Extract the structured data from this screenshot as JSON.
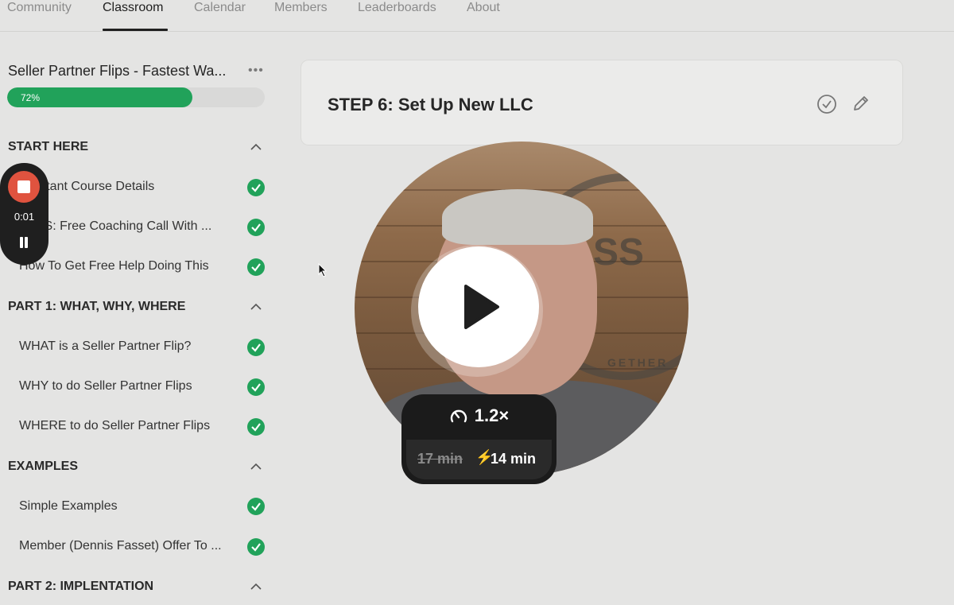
{
  "nav": {
    "tabs": [
      {
        "label": "Community"
      },
      {
        "label": "Classroom"
      },
      {
        "label": "Calendar"
      },
      {
        "label": "Members"
      },
      {
        "label": "Leaderboards"
      },
      {
        "label": "About"
      }
    ],
    "active_tab": "Classroom"
  },
  "course": {
    "title": "Seller Partner Flips - Fastest Wa...",
    "progress_percent": 72,
    "progress_label": "72%",
    "accent_color": "#21a25a"
  },
  "sections": [
    {
      "title": "START HERE",
      "lessons": [
        {
          "label": "Important Course Details",
          "visible_label": "ortant Course Details",
          "completed": true
        },
        {
          "label": "BONUS: Free Coaching Call With ...",
          "visible_label": "US: Free Coaching Call With ...",
          "completed": true
        },
        {
          "label": "How To Get Free Help Doing This",
          "completed": true
        }
      ]
    },
    {
      "title": "PART 1: WHAT, WHY, WHERE",
      "lessons": [
        {
          "label": "WHAT is a Seller Partner Flip?",
          "completed": true
        },
        {
          "label": "WHY to do Seller Partner Flips",
          "completed": true
        },
        {
          "label": "WHERE to do Seller Partner Flips",
          "completed": true
        }
      ]
    },
    {
      "title": "EXAMPLES",
      "lessons": [
        {
          "label": "Simple Examples",
          "completed": true
        },
        {
          "label": "Member (Dennis Fasset) Offer To ...",
          "completed": true
        }
      ]
    },
    {
      "title": "PART 2: IMPLENTATION",
      "lessons": []
    }
  ],
  "recorder": {
    "elapsed": "0:01",
    "stop_color": "#e0533f"
  },
  "lesson_header": {
    "title": "STEP 6: Set Up New LLC"
  },
  "video": {
    "speed": "1.2×",
    "original_duration": "17 min",
    "bolt": "⚡",
    "sped_up_duration": "14 min",
    "backdrop_letters": "SS",
    "backdrop_word": "GETHER"
  }
}
